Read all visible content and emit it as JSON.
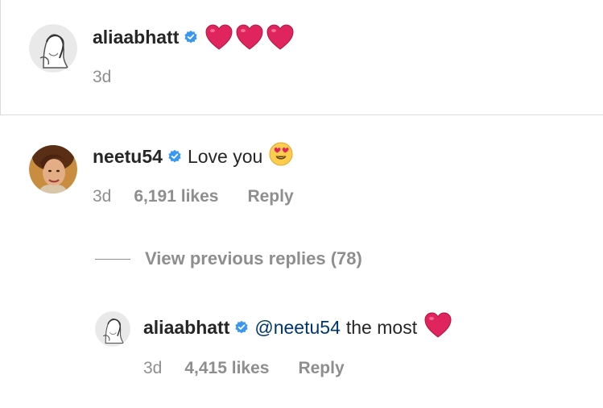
{
  "post_caption": {
    "username": "aliaabhatt",
    "verified": true,
    "hearts": 3,
    "time": "3d"
  },
  "comments": [
    {
      "username": "neetu54",
      "verified": true,
      "text": "Love you",
      "emoji": "heart-eyes-emoji",
      "time": "3d",
      "likes": "6,191 likes",
      "reply_label": "Reply"
    }
  ],
  "view_replies": "View previous replies (78)",
  "reply": {
    "username": "aliaabhatt",
    "verified": true,
    "mention": "@neetu54",
    "text": "the most",
    "emoji": "red-heart-emoji",
    "time": "3d",
    "likes": "4,415 likes",
    "reply_label": "Reply"
  },
  "colors": {
    "verified_badge": "#3897f0",
    "heart": "#e0245e",
    "muted_text": "#8e8e8e",
    "mention": "#00376b"
  }
}
